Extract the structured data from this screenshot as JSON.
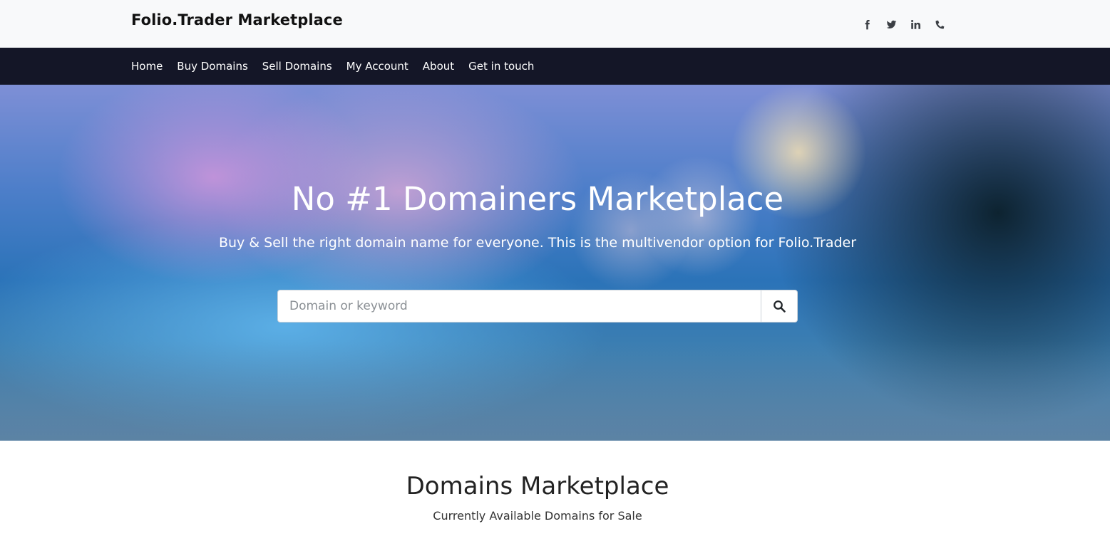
{
  "brand": {
    "name": "Folio.Trader Marketplace"
  },
  "socials": [
    {
      "icon": "facebook-icon"
    },
    {
      "icon": "twitter-icon"
    },
    {
      "icon": "linkedin-icon"
    },
    {
      "icon": "phone-icon"
    }
  ],
  "nav": {
    "items": [
      {
        "label": "Home"
      },
      {
        "label": "Buy Domains"
      },
      {
        "label": "Sell Domains"
      },
      {
        "label": "My Account"
      },
      {
        "label": "About"
      },
      {
        "label": "Get in touch"
      }
    ]
  },
  "hero": {
    "title": "No #1 Domainers Marketplace",
    "subtitle": "Buy & Sell the right domain name for everyone. This is the multivendor option for Folio.Trader",
    "search": {
      "placeholder": "Domain or keyword",
      "value": "",
      "button_icon": "search-icon"
    }
  },
  "marketplace": {
    "title": "Domains Marketplace",
    "subtitle": "Currently Available Domains for Sale"
  },
  "colors": {
    "topbar": "#f8f9fa",
    "navbar": "#141627",
    "text_dark": "#212529"
  }
}
